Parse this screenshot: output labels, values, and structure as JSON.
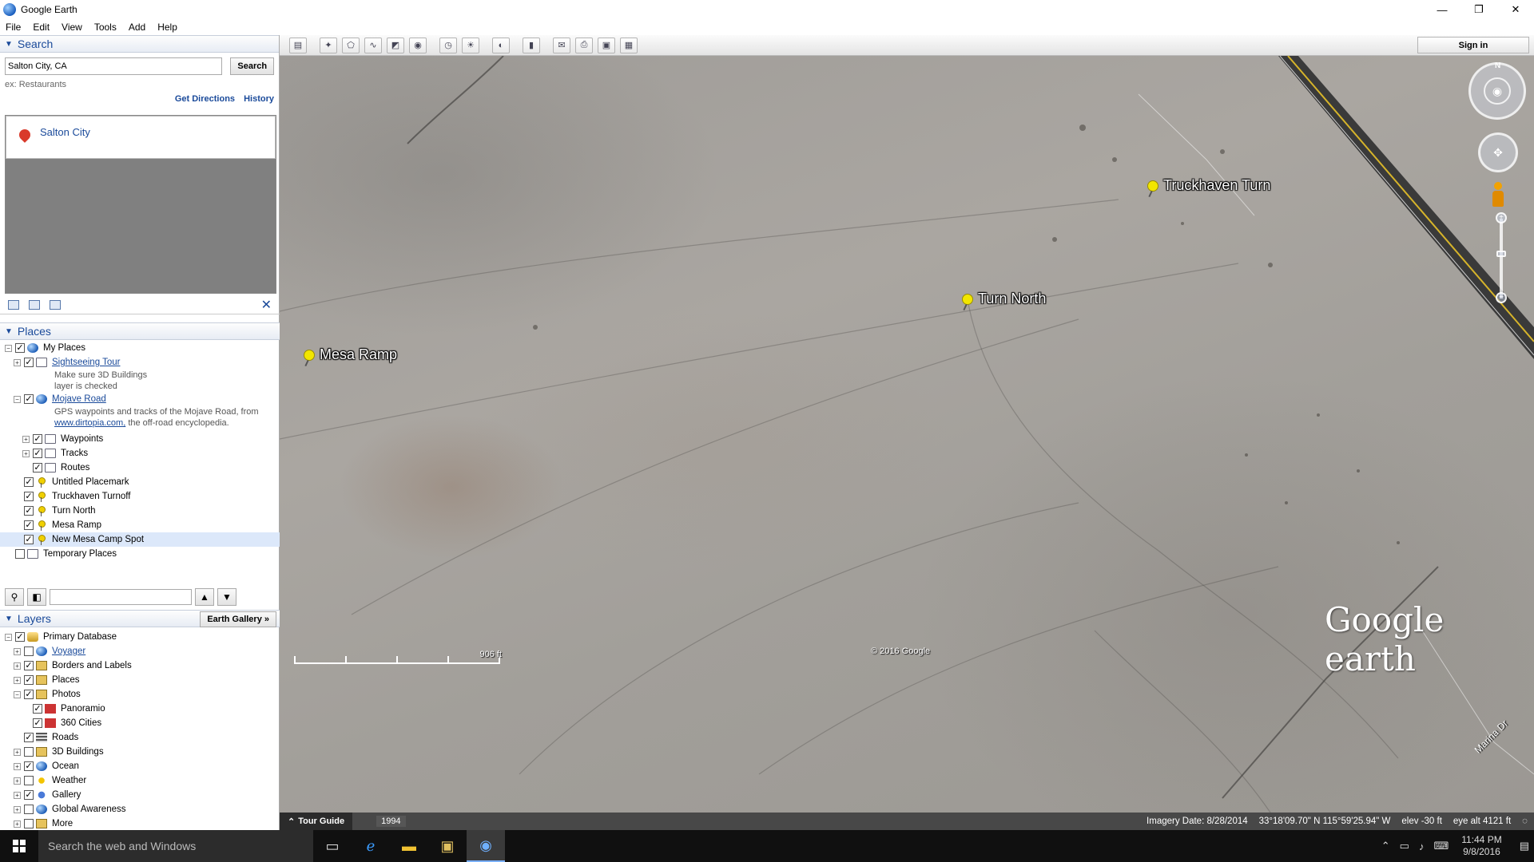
{
  "window": {
    "title": "Google Earth",
    "controls": {
      "minimize": "—",
      "maximize": "❐",
      "close": "✕"
    }
  },
  "menu": [
    "File",
    "Edit",
    "View",
    "Tools",
    "Add",
    "Help"
  ],
  "search": {
    "header": "Search",
    "input_value": "Salton City, CA",
    "button": "Search",
    "example": "ex: Restaurants",
    "links": [
      "Get Directions",
      "History"
    ],
    "results": [
      "Salton City"
    ]
  },
  "places": {
    "header": "Places",
    "items": [
      {
        "label": "My Places",
        "level": 0,
        "checked": true,
        "expander": "−",
        "icon": "globe-icon",
        "link": false
      },
      {
        "label": "Sightseeing Tour",
        "level": 1,
        "checked": true,
        "expander": "+",
        "icon": "folder-icon",
        "link": true
      },
      {
        "label": "Mojave Road",
        "level": 1,
        "checked": true,
        "expander": "−",
        "icon": "globe-icon",
        "link": true
      },
      {
        "label": "Waypoints",
        "level": 2,
        "checked": true,
        "expander": "+",
        "icon": "folder-icon",
        "link": false
      },
      {
        "label": "Tracks",
        "level": 2,
        "checked": true,
        "expander": "+",
        "icon": "folder-icon",
        "link": false
      },
      {
        "label": "Routes",
        "level": 2,
        "checked": true,
        "expander": "",
        "icon": "folder-icon",
        "link": false
      },
      {
        "label": "Untitled Placemark",
        "level": 1,
        "checked": true,
        "expander": "",
        "icon": "pushpin-icon",
        "link": false
      },
      {
        "label": "Truckhaven Turnoff",
        "level": 1,
        "checked": true,
        "expander": "",
        "icon": "pushpin-icon",
        "link": false
      },
      {
        "label": "Turn North",
        "level": 1,
        "checked": true,
        "expander": "",
        "icon": "pushpin-icon",
        "link": false
      },
      {
        "label": "Mesa Ramp",
        "level": 1,
        "checked": true,
        "expander": "",
        "icon": "pushpin-icon",
        "link": false
      },
      {
        "label": "New Mesa Camp Spot",
        "level": 1,
        "checked": true,
        "expander": "",
        "icon": "pushpin-icon",
        "link": false,
        "selected": true
      },
      {
        "label": "Temporary Places",
        "level": 0,
        "checked": false,
        "expander": "",
        "icon": "folder-icon",
        "link": false
      }
    ],
    "descriptions": {
      "sightseeing": [
        "Make sure 3D Buildings",
        "layer is checked"
      ],
      "mojave_line1": "GPS waypoints and tracks of the Mojave Road, from",
      "mojave_link": "www.dirtopia.com,",
      "mojave_line2_rest": " the off-road encyclopedia."
    }
  },
  "layers": {
    "header": "Layers",
    "gallery_button": "Earth Gallery »",
    "items": [
      {
        "label": "Primary Database",
        "level": 0,
        "checked": true,
        "expander": "−",
        "icon": "database-icon",
        "link": false
      },
      {
        "label": "Voyager",
        "level": 1,
        "checked": false,
        "expander": "+",
        "icon": "globe-icon",
        "link": true
      },
      {
        "label": "Borders and Labels",
        "level": 1,
        "checked": true,
        "expander": "+",
        "icon": "borders-icon",
        "link": false
      },
      {
        "label": "Places",
        "level": 1,
        "checked": true,
        "expander": "+",
        "icon": "places-icon",
        "link": false
      },
      {
        "label": "Photos",
        "level": 1,
        "checked": true,
        "expander": "−",
        "icon": "photos-icon",
        "link": false
      },
      {
        "label": "Panoramio",
        "level": 2,
        "checked": true,
        "expander": "",
        "icon": "panoramio-icon",
        "link": false
      },
      {
        "label": "360 Cities",
        "level": 2,
        "checked": true,
        "expander": "",
        "icon": "cities-icon",
        "link": false
      },
      {
        "label": "Roads",
        "level": 1,
        "checked": true,
        "expander": "",
        "icon": "roads-icon",
        "link": false
      },
      {
        "label": "3D Buildings",
        "level": 1,
        "checked": false,
        "expander": "+",
        "icon": "buildings-icon",
        "link": false
      },
      {
        "label": "Ocean",
        "level": 1,
        "checked": true,
        "expander": "+",
        "icon": "ocean-icon",
        "link": false
      },
      {
        "label": "Weather",
        "level": 1,
        "checked": false,
        "expander": "+",
        "icon": "weather-icon",
        "link": false
      },
      {
        "label": "Gallery",
        "level": 1,
        "checked": true,
        "expander": "+",
        "icon": "gallery-icon",
        "link": false
      },
      {
        "label": "Global Awareness",
        "level": 1,
        "checked": false,
        "expander": "+",
        "icon": "awareness-icon",
        "link": false
      },
      {
        "label": "More",
        "level": 1,
        "checked": false,
        "expander": "+",
        "icon": "more-icon",
        "link": false
      }
    ]
  },
  "toolbar": {
    "buttons": [
      "sidebar-icon",
      "placemark-icon",
      "polygon-icon",
      "path-icon",
      "image-overlay-icon",
      "record-tour-icon",
      "historical-imagery-icon",
      "sunlight-icon",
      "planets-icon",
      "ruler-icon",
      "email-icon",
      "print-icon",
      "save-image-icon",
      "view-in-maps-icon"
    ],
    "sign_in": "Sign in"
  },
  "map": {
    "placemarks": [
      "Truckhaven Turn",
      "Turn North",
      "Mesa Ramp"
    ],
    "nav_north": "N",
    "scale_label": "906 ft",
    "copyright": "© 2016 Google",
    "logo": "Google earth",
    "road_label": "Marina Dr"
  },
  "status": {
    "tour_guide": "Tour Guide",
    "history_year": "1994",
    "imagery_date": "Imagery Date: 8/28/2014",
    "coordinates": "33°18'09.70\" N  115°59'25.94\" W",
    "elevation": "elev   -30 ft",
    "eye_alt": "eye alt  4121 ft"
  },
  "taskbar": {
    "search_placeholder": "Search the web and Windows",
    "time": "11:44 PM",
    "date": "9/8/2016"
  }
}
